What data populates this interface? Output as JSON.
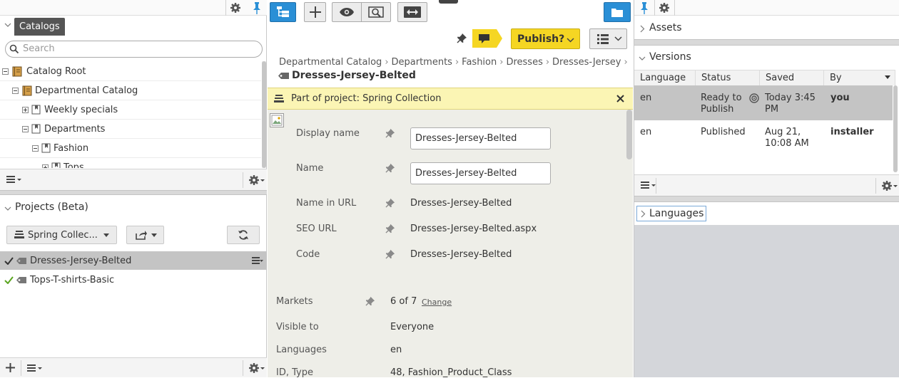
{
  "left": {
    "catalogs_title": "Catalogs",
    "search_placeholder": "Search",
    "tree": [
      {
        "label": "Catalog Root"
      },
      {
        "label": "Departmental Catalog"
      },
      {
        "label": "Weekly specials"
      },
      {
        "label": "Departments"
      },
      {
        "label": "Fashion"
      },
      {
        "label": "Tops"
      }
    ],
    "projects_title": "Projects (Beta)",
    "project_select": "Spring Collec...",
    "project_items": [
      {
        "label": "Dresses-Jersey-Belted"
      },
      {
        "label": "Tops-T-shirts-Basic"
      }
    ]
  },
  "middle": {
    "publish_label": "Publish?",
    "breadcrumb": [
      "Departmental Catalog",
      "Departments",
      "Fashion",
      "Dresses",
      "Dresses-Jersey"
    ],
    "page_title": "Dresses-Jersey-Belted",
    "project_banner": "Part of project: Spring Collection",
    "fields": {
      "display_name_label": "Display name",
      "display_name_value": "Dresses-Jersey-Belted",
      "name_label": "Name",
      "name_value": "Dresses-Jersey-Belted",
      "name_in_url_label": "Name in URL",
      "name_in_url_value": "Dresses-Jersey-Belted",
      "seo_url_label": "SEO URL",
      "seo_url_value": "Dresses-Jersey-Belted.aspx",
      "code_label": "Code",
      "code_value": "Dresses-Jersey-Belted"
    },
    "info": {
      "markets_label": "Markets",
      "markets_value": "6 of 7",
      "markets_change": "Change",
      "visible_label": "Visible to",
      "visible_value": "Everyone",
      "languages_label": "Languages",
      "languages_value": "en",
      "idtype_label": "ID, Type",
      "idtype_value": "48, Fashion_Product_Class"
    }
  },
  "right": {
    "assets_title": "Assets",
    "versions_title": "Versions",
    "columns": [
      "Language",
      "Status",
      "Saved",
      "By"
    ],
    "rows": [
      {
        "language": "en",
        "status_1": "Ready to",
        "status_2": "Publish",
        "saved_1": "Today 3:45",
        "saved_2": "PM",
        "by": "you"
      },
      {
        "language": "en",
        "status_1": "Published",
        "status_2": "",
        "saved_1": "Aug 21,",
        "saved_2": "10:08 AM",
        "by": "installer"
      }
    ],
    "languages_title": "Languages"
  },
  "colors": {
    "accent": "#2a8fd6",
    "banner": "#fbf5b4",
    "publish": "#f5d623",
    "selected_row": "#c4c4c4"
  }
}
